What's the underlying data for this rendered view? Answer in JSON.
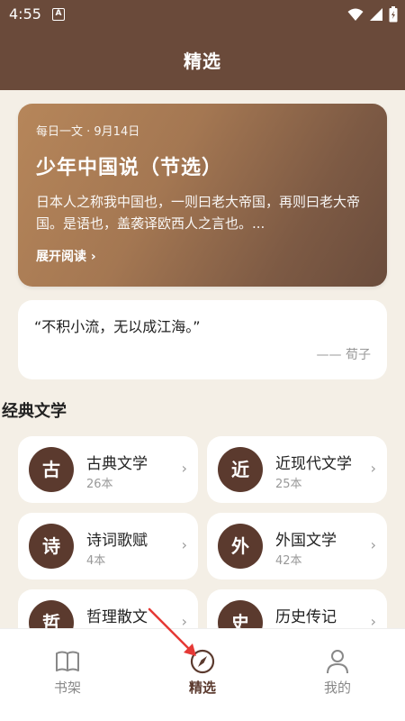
{
  "status_bar": {
    "time": "4:55",
    "badge": "A",
    "icons": [
      "wifi-icon",
      "signal-icon",
      "battery-icon"
    ]
  },
  "header": {
    "title": "精选"
  },
  "daily": {
    "meta": "每日一文 · 9月14日",
    "title": "少年中国说（节选）",
    "excerpt": "日本人之称我中国也，一则曰老大帝国，再则曰老大帝国。是语也，盖袭译欧西人之言也。...",
    "read_more": "展开阅读 ›"
  },
  "quote": {
    "text": "“不积小流，无以成江海。”",
    "author": "—— 荀子"
  },
  "section": {
    "title": "经典文学"
  },
  "categories": [
    {
      "char": "古",
      "name": "古典文学",
      "count": "26本"
    },
    {
      "char": "近",
      "name": "近现代文学",
      "count": "25本"
    },
    {
      "char": "诗",
      "name": "诗词歌赋",
      "count": "4本"
    },
    {
      "char": "外",
      "name": "外国文学",
      "count": "42本"
    },
    {
      "char": "哲",
      "name": "哲理散文",
      "count": ""
    },
    {
      "char": "史",
      "name": "历史传记",
      "count": ""
    }
  ],
  "chevron": "›",
  "bottom_nav": [
    {
      "label": "书架",
      "icon": "book-icon"
    },
    {
      "label": "精选",
      "icon": "compass-icon"
    },
    {
      "label": "我的",
      "icon": "user-icon"
    }
  ],
  "colors": {
    "header": "#6a4a3a",
    "accent": "#5b3a2e",
    "background": "#f4efe6",
    "annotation": "#e53935"
  }
}
